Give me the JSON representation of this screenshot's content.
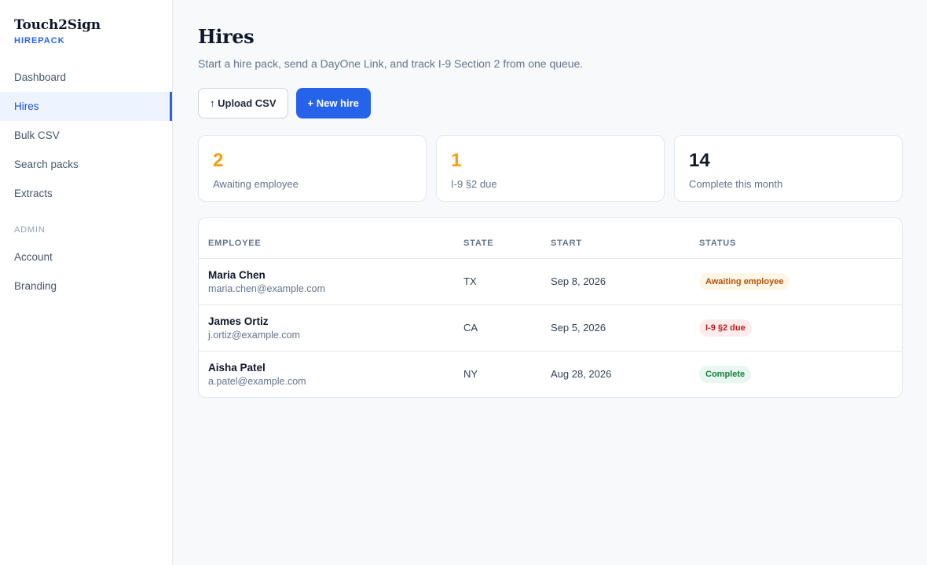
{
  "sidebar": {
    "brand": "Touch2Sign",
    "brand_sub": "HIREPACK",
    "items": [
      {
        "label": "Dashboard"
      },
      {
        "label": "Hires"
      },
      {
        "label": "Bulk CSV"
      },
      {
        "label": "Search packs"
      },
      {
        "label": "Extracts"
      }
    ],
    "admin_heading": "ADMIN",
    "admin_items": [
      {
        "label": "Account"
      },
      {
        "label": "Branding"
      }
    ]
  },
  "header": {
    "title": "Hires",
    "subtitle": "Start a hire pack, send a DayOne Link, and track I-9 Section 2 from one queue."
  },
  "actions": {
    "upload_label": "↑ Upload CSV",
    "new_hire_label": "+ New hire"
  },
  "stats": [
    {
      "value": "2",
      "label": "Awaiting employee",
      "color": "#f59e0b"
    },
    {
      "value": "1",
      "label": "I-9 §2 due",
      "color": "#f59e0b"
    },
    {
      "value": "14",
      "label": "Complete this month",
      "color": "#0f172a"
    }
  ],
  "table": {
    "headers": [
      "EMPLOYEE",
      "STATE",
      "START",
      "STATUS"
    ],
    "rows": [
      {
        "name": "Maria Chen",
        "email": "maria.chen@example.com",
        "state": "TX",
        "start": "Sep 8, 2026",
        "status": "Awaiting employee",
        "status_bg": "#fef6e7",
        "status_fg": "#b45309"
      },
      {
        "name": "James Ortiz",
        "email": "j.ortiz@example.com",
        "state": "CA",
        "start": "Sep 5, 2026",
        "status": "I-9 §2 due",
        "status_bg": "#fdecec",
        "status_fg": "#b91c1c"
      },
      {
        "name": "Aisha Patel",
        "email": "a.patel@example.com",
        "state": "NY",
        "start": "Aug 28, 2026",
        "status": "Complete",
        "status_bg": "#e8f7ef",
        "status_fg": "#15803d"
      }
    ]
  },
  "colors": {
    "accent": "#2563eb",
    "active_nav_bg": "#eef4ff"
  }
}
